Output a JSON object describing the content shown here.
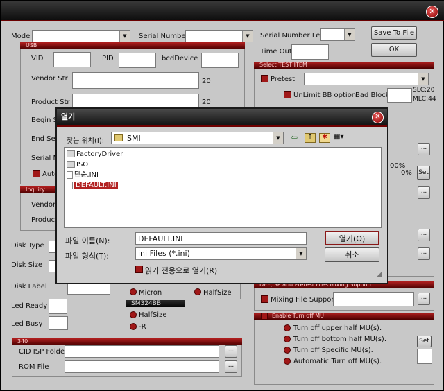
{
  "main": {
    "mode_label": "Mode",
    "serial_number_label": "Serial Number",
    "serial_number_len_label": "Serial Number Len",
    "time_out_label": "Time Out",
    "save_to_file_label": "Save To File",
    "ok_label": "OK"
  },
  "usb": {
    "header": "USB",
    "vid_label": "VID",
    "pid_label": "PID",
    "bcd_label": "bcdDevice",
    "vendor_str_label": "Vendor Str",
    "vendor_str_len": "20",
    "product_str_label": "Product Str",
    "product_str_len": "20",
    "begin_label": "Begin Se",
    "end_label": "End Ser",
    "serial_m_label": "Serial M",
    "auto_label": "Auto"
  },
  "inquiry": {
    "header": "Inquiry",
    "vendor_label": "Vendor",
    "product_label": "Product"
  },
  "disk": {
    "type_label": "Disk Type",
    "size_label": "Disk Size",
    "label_label": "Disk Label",
    "led_ready_label": "Led Ready",
    "led_busy_label": "Led Busy"
  },
  "fourradio": {
    "micron_label": "Micron",
    "halfsize_label": "HalfSize"
  },
  "sm324bb": {
    "header": "SM324BB",
    "halfsize_label": "HalfSize",
    "r_label": "-R"
  },
  "isp340": {
    "header": "340",
    "cid_label": "CID ISP Folder",
    "rom_label": "ROM File"
  },
  "select_test": {
    "header": "Select TEST ITEM",
    "pretest_label": "Pretest",
    "unlimit_label": "UnLimit BB option",
    "bad_block_label": "Bad Block",
    "slc_label": "SLC:20",
    "mlc_label": "MLC:44",
    "pct_label": "00%",
    "zero_pct_label": "0%",
    "set_label": "Set"
  },
  "mixing": {
    "header": "DEF,ISP and Pretest Files Mixing Support",
    "label": "Mixing File Support"
  },
  "turnoff": {
    "header": "Enable Turn off MU",
    "items": [
      "Turn off upper half MU(s).",
      "Turn off bottom half MU(s).",
      "Turn off Specific MU(s).",
      "Automatic Turn off MU(s)."
    ],
    "set_label": "Set"
  },
  "dialog": {
    "title": "열기",
    "look_in_label": "찾는 위치(I):",
    "look_in_value": "SMI",
    "files": [
      {
        "name": "FactoryDriver",
        "type": "folder"
      },
      {
        "name": "ISO",
        "type": "folder"
      },
      {
        "name": "단순.INI",
        "type": "file"
      },
      {
        "name": "DEFAULT.INI",
        "type": "file",
        "selected": true
      }
    ],
    "filename_label": "파일 이름(N):",
    "filename_value": "DEFAULT.INI",
    "filetype_label": "파일 형식(T):",
    "filetype_value": "ini Files (*.ini)",
    "readonly_label": "읽기 전용으로 열기(R)",
    "open_label": "열기(O)",
    "cancel_label": "취소"
  },
  "colors": {
    "accent": "#a01818",
    "title_dark": "#121212",
    "selection": "#b22222"
  }
}
